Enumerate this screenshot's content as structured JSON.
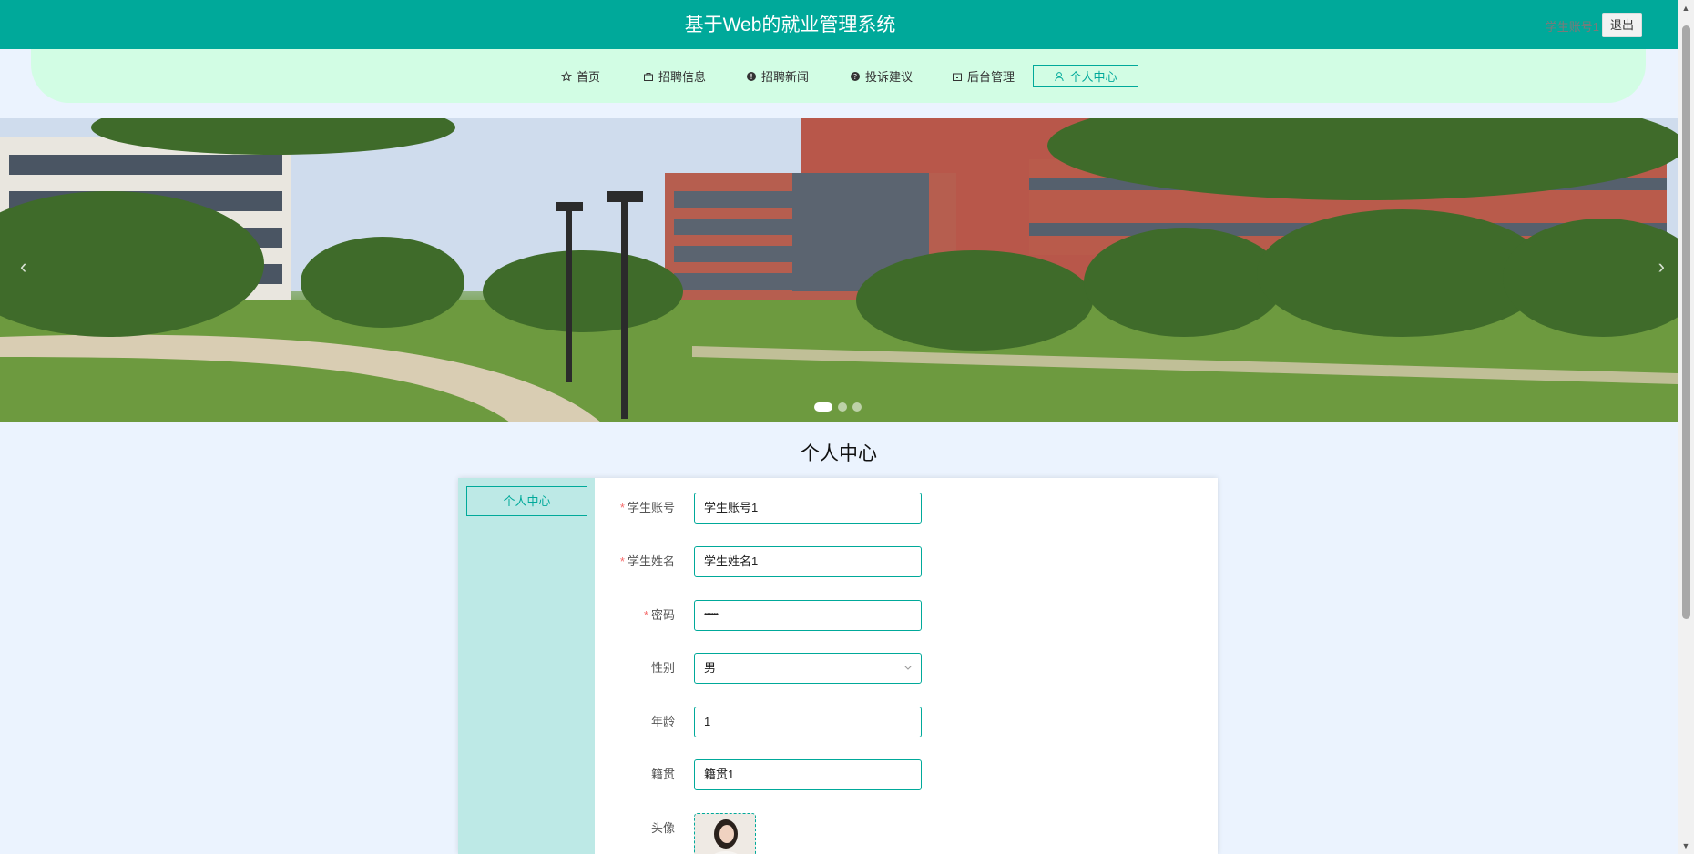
{
  "header": {
    "title": "基于Web的就业管理系统",
    "user_name": "学生账号1",
    "logout_label": "退出"
  },
  "nav": {
    "items": [
      {
        "label": "首页",
        "icon": "star-icon"
      },
      {
        "label": "招聘信息",
        "icon": "briefcase-icon"
      },
      {
        "label": "招聘新闻",
        "icon": "info-icon"
      },
      {
        "label": "投诉建议",
        "icon": "question-icon"
      },
      {
        "label": "后台管理",
        "icon": "box-icon"
      },
      {
        "label": "个人中心",
        "icon": "user-icon",
        "active": true
      }
    ]
  },
  "banner": {
    "slides": 3,
    "active_slide": 1
  },
  "page": {
    "title": "个人中心"
  },
  "sidebar": {
    "active_label": "个人中心"
  },
  "form": {
    "fields": [
      {
        "label": "学生账号",
        "required": true,
        "value": "学生账号1",
        "type": "text"
      },
      {
        "label": "学生姓名",
        "required": true,
        "value": "学生姓名1",
        "type": "text"
      },
      {
        "label": "密码",
        "required": true,
        "value": "••••••",
        "type": "password"
      },
      {
        "label": "性别",
        "required": false,
        "value": "男",
        "type": "select"
      },
      {
        "label": "年龄",
        "required": false,
        "value": "1",
        "type": "text"
      },
      {
        "label": "籍贯",
        "required": false,
        "value": "籍贯1",
        "type": "text"
      },
      {
        "label": "头像",
        "required": false,
        "type": "image"
      }
    ],
    "required_marker": "*"
  },
  "colors": {
    "primary": "#00a99a",
    "nav_bg": "#d2fde4",
    "side_bg": "#bde9e6",
    "page_bg": "#ebf3fe",
    "required": "#f56c6c"
  }
}
